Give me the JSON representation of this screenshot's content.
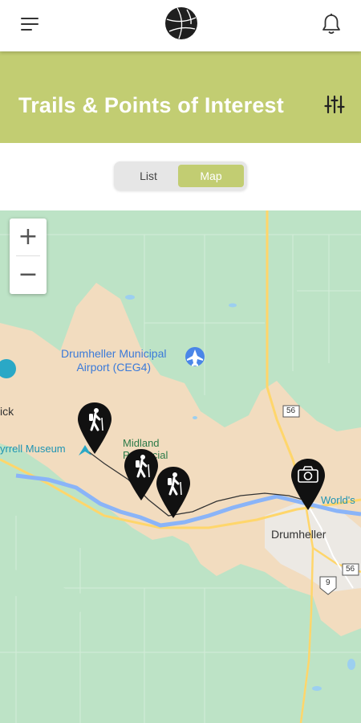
{
  "header": {
    "menu_icon": "hamburger-menu-icon",
    "logo_icon": "basketball-logo-icon",
    "notification_icon": "bell-icon"
  },
  "banner": {
    "title": "Trails & Points of Interest",
    "filter_icon": "sliders-filter-icon",
    "background_color": "#c2cd72"
  },
  "view_toggle": {
    "list_label": "List",
    "map_label": "Map",
    "selected": "Map"
  },
  "map": {
    "zoom_in": "+",
    "zoom_out": "−",
    "labels": {
      "airport": "Drumheller Municipal\nAirport (CEG4)",
      "midland": "Midland",
      "midland2": "Provincial",
      "museum": "yrrell Museum",
      "drumheller": "Drumheller",
      "worlds": "World's",
      "ick": "ick",
      "route56_a": "56",
      "route56_b": "56",
      "route9": "9"
    },
    "markers": [
      {
        "type": "hiking",
        "icon": "hiker-icon"
      },
      {
        "type": "hiking",
        "icon": "hiker-icon"
      },
      {
        "type": "hiking",
        "icon": "hiker-icon"
      },
      {
        "type": "photo",
        "icon": "camera-icon"
      }
    ]
  }
}
